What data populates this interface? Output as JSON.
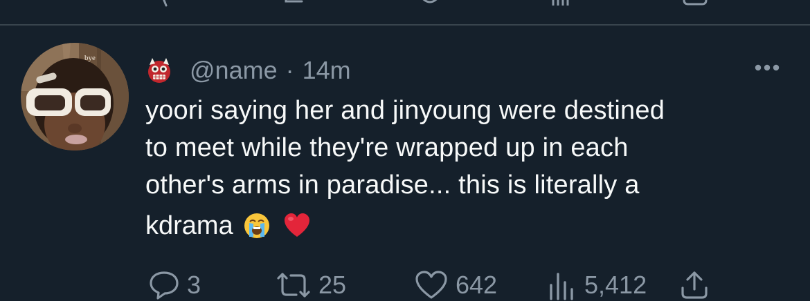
{
  "tweet": {
    "handle": "@name",
    "separator": "·",
    "time": "14m",
    "avatar_text": "bye",
    "text_lines": [
      "yoori saying her and jinyoung were destined",
      "to meet while they're wrapped up in each",
      "other's arms in paradise... this is literally a"
    ],
    "last_line": "kdrama",
    "emojis": [
      "loudly-crying-face-emoji",
      "red-heart-emoji"
    ],
    "badge_icon": "ogre-emoji"
  },
  "actions": {
    "reply_count": "3",
    "retweet_count": "25",
    "like_count": "642",
    "views_count": "5,412"
  },
  "icons": {
    "reply": "reply-icon",
    "retweet": "retweet-icon",
    "like": "heart-icon",
    "views": "views-icon",
    "share": "share-icon",
    "more": "more-icon"
  },
  "colors": {
    "background": "#15202b",
    "divider": "#38444d",
    "text_primary": "#f7f9f9",
    "text_secondary": "#8b98a5"
  }
}
